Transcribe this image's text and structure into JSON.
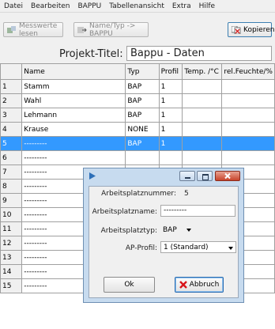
{
  "menu": [
    "Datei",
    "Bearbeiten",
    "BAPPU",
    "Tabellenansicht",
    "Extra",
    "Hilfe"
  ],
  "toolbar": {
    "measure_label": "Messwerte lesen",
    "nametype_label": "Name/Typ -> BAPPU",
    "copy_label": "Kopieren"
  },
  "project": {
    "label": "Projekt-Titel:",
    "value": "Bappu - Daten"
  },
  "grid": {
    "headers": [
      "",
      "Name",
      "Typ",
      "Profil",
      "Temp. /°C",
      "rel.Feuchte/%"
    ],
    "rows": [
      [
        "1",
        "Stamm",
        "BAP",
        "1",
        "",
        ""
      ],
      [
        "2",
        "Wahl",
        "BAP",
        "1",
        "",
        ""
      ],
      [
        "3",
        "Lehmann",
        "BAP",
        "1",
        "",
        ""
      ],
      [
        "4",
        "Krause",
        "NONE",
        "1",
        "",
        ""
      ],
      [
        "5",
        "---------",
        "BAP",
        "1",
        "",
        ""
      ],
      [
        "6",
        "---------",
        "",
        "",
        "",
        ""
      ],
      [
        "7",
        "---------",
        "",
        "",
        "",
        ""
      ],
      [
        "8",
        "---------",
        "",
        "",
        "",
        ""
      ],
      [
        "9",
        "---------",
        "",
        "",
        "",
        ""
      ],
      [
        "10",
        "---------",
        "",
        "",
        "",
        ""
      ],
      [
        "11",
        "---------",
        "",
        "",
        "",
        ""
      ],
      [
        "12",
        "---------",
        "",
        "",
        "",
        ""
      ],
      [
        "13",
        "---------",
        "",
        "",
        "",
        ""
      ],
      [
        "14",
        "---------",
        "",
        "",
        "",
        ""
      ],
      [
        "15",
        "---------",
        "BAP",
        "1",
        "",
        ""
      ]
    ],
    "selected_row": 5
  },
  "dialog": {
    "nummer_label": "Arbeitsplatznummer:",
    "nummer_value": "5",
    "name_label": "Arbeitsplatzname:",
    "name_value": "---------",
    "typ_label": "Arbeitsplatztyp:",
    "typ_value": "BAP",
    "profil_label": "AP-Profil:",
    "profil_value": "1 (Standard)",
    "ok_label": "Ok",
    "cancel_label": "Abbruch"
  },
  "colors": {
    "selection": "#3399ff",
    "dialog_frame": "#c7dbef",
    "close_button": "#c8442b"
  }
}
